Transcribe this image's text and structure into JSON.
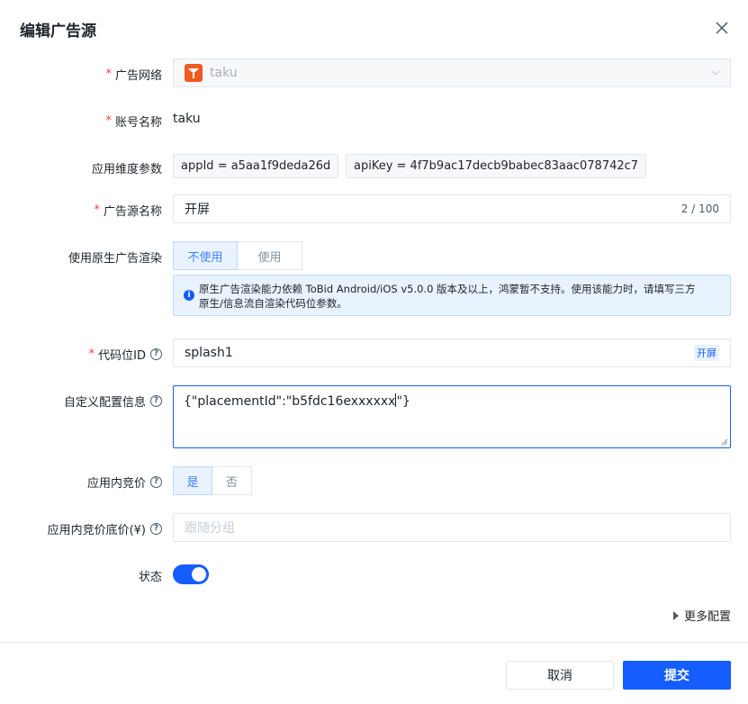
{
  "dialog": {
    "title": "编辑广告源"
  },
  "fields": {
    "network": {
      "label": "广告网络",
      "value": "taku"
    },
    "account": {
      "label": "账号名称",
      "value": "taku"
    },
    "app_params": {
      "label": "应用维度参数",
      "items": [
        "appId  =  a5aa1f9deda26d",
        "apiKey  =  4f7b9ac17decb9babec83aac078742c7"
      ]
    },
    "source_name": {
      "label": "广告源名称",
      "value": "开屏",
      "count": "2 / 100"
    },
    "native_render": {
      "label": "使用原生广告渲染",
      "options": [
        "不使用",
        "使用"
      ],
      "notice_line1": "原生广告渲染能力依赖 ToBid Android/iOS v5.0.0 版本及以上，鸿蒙暂不支持。使用该能力时，请填写三方",
      "notice_line2": "原生/信息流自渲染代码位参数。"
    },
    "placement_id": {
      "label": "代码位ID",
      "value": "splash1",
      "tag": "开屏"
    },
    "custom_config": {
      "label": "自定义配置信息",
      "value_before_caret": "{\"placementId\":\"b5fdc16exxxxxx",
      "value_after_caret": "\"}"
    },
    "bidding": {
      "label": "应用内竞价",
      "options": [
        "是",
        "否"
      ]
    },
    "floor_price": {
      "label": "应用内竞价底价(¥)",
      "placeholder": "跟随分组"
    },
    "status": {
      "label": "状态",
      "on": true
    }
  },
  "more": {
    "label": "更多配置"
  },
  "footer": {
    "cancel": "取消",
    "submit": "提交"
  },
  "colors": {
    "primary": "#165dff",
    "required": "#f53f3f",
    "logo": "#ee5a24"
  },
  "icons": {
    "close": "close-icon",
    "chevron": "chevron-down-icon",
    "help": "question-circle-icon",
    "info": "info-icon"
  }
}
